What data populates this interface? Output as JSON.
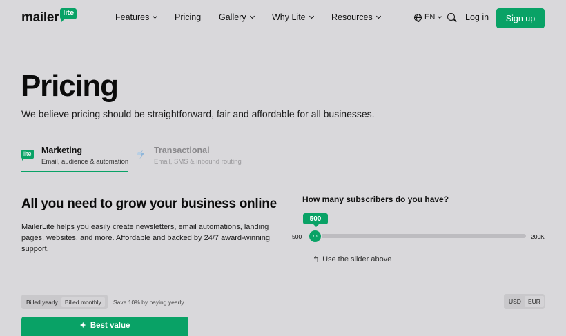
{
  "header": {
    "logo_word": "mailer",
    "logo_badge": "lite",
    "nav": [
      "Features",
      "Pricing",
      "Gallery",
      "Why Lite",
      "Resources"
    ],
    "lang": "EN",
    "login": "Log in",
    "signup": "Sign up"
  },
  "hero": {
    "title": "Pricing",
    "subtitle": "We believe pricing should be straightforward, fair and affordable for all businesses."
  },
  "tabs": [
    {
      "icon_badge": "lite",
      "title": "Marketing",
      "desc": "Email, audience & automation"
    },
    {
      "title": "Transactional",
      "desc": "Email, SMS & inbound routing"
    }
  ],
  "content": {
    "heading": "All you need to grow your business online",
    "description": "MailerLite helps you easily create newsletters, email automations, landing pages, websites, and more. Affordable and backed by 24/7 award-winning support."
  },
  "slider": {
    "question": "How many subscribers do you have?",
    "value": "500",
    "min": "500",
    "max": "200K",
    "hint": "Use the slider above",
    "handle_glyph": "‹ ›",
    "progress": 0
  },
  "billing": {
    "options": [
      "Billed yearly",
      "Billed monthly"
    ],
    "active": "Billed monthly",
    "note": "Save 10% by paying yearly"
  },
  "currency": {
    "options": [
      "USD",
      "EUR"
    ],
    "active": "EUR"
  },
  "card": {
    "badge": "Best value",
    "badge_icon": "sparkle-icon"
  },
  "colors": {
    "brand": "#09a266",
    "background": "#d9d8db"
  }
}
